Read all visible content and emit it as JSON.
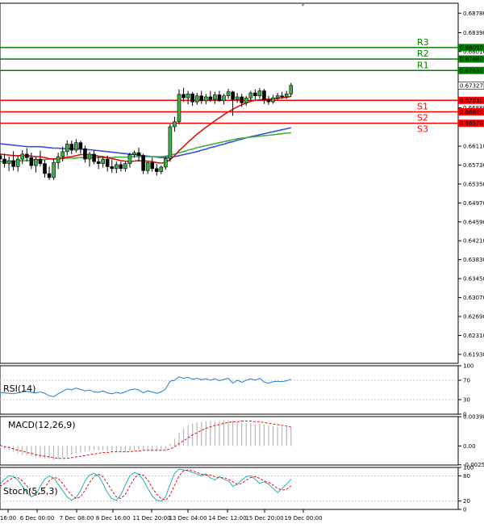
{
  "chart_data": [
    {
      "type": "candlestick",
      "panel": "price",
      "ylim": [
        0.6175,
        0.6898
      ],
      "y_ticks": [
        "0.68780",
        "0.68390",
        "0.68010",
        "0.67630",
        "0.67330",
        "0.66880",
        "0.66570",
        "0.66110",
        "0.65730",
        "0.65350",
        "0.64970",
        "0.64590",
        "0.64210",
        "0.63830",
        "0.63450",
        "0.63070",
        "0.62690",
        "0.62310",
        "0.61930"
      ],
      "y_tick_values": [
        0.6878,
        0.6839,
        0.6801,
        0.6763,
        0.6733,
        0.6688,
        0.6657,
        0.6611,
        0.6573,
        0.6535,
        0.6497,
        0.6459,
        0.6421,
        0.6383,
        0.6345,
        0.6307,
        0.6269,
        0.6231,
        0.6193
      ],
      "x_ticks": [
        "16:00",
        "6 Dec 00:00",
        "7 Dec 08:00",
        "8 Dec 16:00",
        "11 Dec 20:00",
        "13 Dec 04:00",
        "14 Dec 12:00",
        "15 Dec 20:00",
        "19 Dec 00:00"
      ],
      "levels": [
        {
          "name": "R3",
          "value": 0.6809,
          "label": "0.68090",
          "color": "#008000"
        },
        {
          "name": "R2",
          "value": 0.6786,
          "label": "0.67860",
          "color": "#008000"
        },
        {
          "name": "R1",
          "value": 0.6763,
          "label": "0.67630",
          "color": "#008000"
        },
        {
          "name": "S1",
          "value": 0.6703,
          "label": "0.67030",
          "color": "#ff0000"
        },
        {
          "name": "S2",
          "value": 0.668,
          "label": "0.66800",
          "color": "#ff0000"
        },
        {
          "name": "S3",
          "value": 0.6657,
          "label": "0.66570",
          "color": "#ff0000"
        }
      ],
      "current_price": {
        "value": 0.67327,
        "label": "0.67327"
      },
      "candles": [
        {
          "o": 0.6592,
          "h": 0.6605,
          "l": 0.6578,
          "c": 0.6585
        },
        {
          "o": 0.6585,
          "h": 0.6596,
          "l": 0.6568,
          "c": 0.6576
        },
        {
          "o": 0.6576,
          "h": 0.659,
          "l": 0.6561,
          "c": 0.6582
        },
        {
          "o": 0.6582,
          "h": 0.6601,
          "l": 0.6562,
          "c": 0.657
        },
        {
          "o": 0.657,
          "h": 0.6591,
          "l": 0.656,
          "c": 0.6585
        },
        {
          "o": 0.6585,
          "h": 0.6603,
          "l": 0.6575,
          "c": 0.6595
        },
        {
          "o": 0.6595,
          "h": 0.6607,
          "l": 0.658,
          "c": 0.6588
        },
        {
          "o": 0.6588,
          "h": 0.6598,
          "l": 0.6565,
          "c": 0.6572
        },
        {
          "o": 0.6572,
          "h": 0.659,
          "l": 0.6558,
          "c": 0.6585
        },
        {
          "o": 0.6585,
          "h": 0.6602,
          "l": 0.657,
          "c": 0.6576
        },
        {
          "o": 0.6576,
          "h": 0.6584,
          "l": 0.6548,
          "c": 0.6556
        },
        {
          "o": 0.6556,
          "h": 0.657,
          "l": 0.6543,
          "c": 0.6548
        },
        {
          "o": 0.6548,
          "h": 0.6585,
          "l": 0.6543,
          "c": 0.6578
        },
        {
          "o": 0.6578,
          "h": 0.6598,
          "l": 0.6565,
          "c": 0.659
        },
        {
          "o": 0.659,
          "h": 0.661,
          "l": 0.658,
          "c": 0.66
        },
        {
          "o": 0.66,
          "h": 0.6623,
          "l": 0.6592,
          "c": 0.6615
        },
        {
          "o": 0.6615,
          "h": 0.6622,
          "l": 0.6595,
          "c": 0.6603
        },
        {
          "o": 0.6603,
          "h": 0.6625,
          "l": 0.6598,
          "c": 0.6618
        },
        {
          "o": 0.6618,
          "h": 0.6622,
          "l": 0.6596,
          "c": 0.6606
        },
        {
          "o": 0.6606,
          "h": 0.6612,
          "l": 0.6578,
          "c": 0.6585
        },
        {
          "o": 0.6585,
          "h": 0.66,
          "l": 0.657,
          "c": 0.6595
        },
        {
          "o": 0.6595,
          "h": 0.6602,
          "l": 0.6575,
          "c": 0.658
        },
        {
          "o": 0.658,
          "h": 0.659,
          "l": 0.6565,
          "c": 0.6576
        },
        {
          "o": 0.6576,
          "h": 0.659,
          "l": 0.6568,
          "c": 0.6585
        },
        {
          "o": 0.6585,
          "h": 0.6592,
          "l": 0.656,
          "c": 0.657
        },
        {
          "o": 0.657,
          "h": 0.6584,
          "l": 0.6558,
          "c": 0.6566
        },
        {
          "o": 0.6566,
          "h": 0.658,
          "l": 0.6557,
          "c": 0.6574
        },
        {
          "o": 0.6574,
          "h": 0.658,
          "l": 0.656,
          "c": 0.6566
        },
        {
          "o": 0.6566,
          "h": 0.658,
          "l": 0.656,
          "c": 0.6576
        },
        {
          "o": 0.6576,
          "h": 0.6598,
          "l": 0.6568,
          "c": 0.6594
        },
        {
          "o": 0.6594,
          "h": 0.6602,
          "l": 0.6588,
          "c": 0.6598
        },
        {
          "o": 0.6598,
          "h": 0.6608,
          "l": 0.658,
          "c": 0.6592
        },
        {
          "o": 0.6592,
          "h": 0.6596,
          "l": 0.6555,
          "c": 0.6562
        },
        {
          "o": 0.6562,
          "h": 0.658,
          "l": 0.6555,
          "c": 0.6578
        },
        {
          "o": 0.6578,
          "h": 0.6588,
          "l": 0.656,
          "c": 0.6566
        },
        {
          "o": 0.6566,
          "h": 0.6575,
          "l": 0.6552,
          "c": 0.656
        },
        {
          "o": 0.656,
          "h": 0.6572,
          "l": 0.6555,
          "c": 0.6569
        },
        {
          "o": 0.6569,
          "h": 0.659,
          "l": 0.6564,
          "c": 0.6586
        },
        {
          "o": 0.6586,
          "h": 0.6655,
          "l": 0.658,
          "c": 0.665
        },
        {
          "o": 0.665,
          "h": 0.667,
          "l": 0.664,
          "c": 0.666
        },
        {
          "o": 0.666,
          "h": 0.6725,
          "l": 0.6655,
          "c": 0.6715
        },
        {
          "o": 0.6715,
          "h": 0.6728,
          "l": 0.67,
          "c": 0.6708
        },
        {
          "o": 0.6708,
          "h": 0.6722,
          "l": 0.6695,
          "c": 0.6716
        },
        {
          "o": 0.6716,
          "h": 0.672,
          "l": 0.6692,
          "c": 0.67
        },
        {
          "o": 0.67,
          "h": 0.6718,
          "l": 0.6694,
          "c": 0.6712
        },
        {
          "o": 0.6712,
          "h": 0.6722,
          "l": 0.6696,
          "c": 0.6702
        },
        {
          "o": 0.6702,
          "h": 0.6716,
          "l": 0.6695,
          "c": 0.671
        },
        {
          "o": 0.671,
          "h": 0.6722,
          "l": 0.67,
          "c": 0.6705
        },
        {
          "o": 0.6705,
          "h": 0.672,
          "l": 0.6696,
          "c": 0.6714
        },
        {
          "o": 0.6714,
          "h": 0.6722,
          "l": 0.67,
          "c": 0.6702
        },
        {
          "o": 0.6702,
          "h": 0.6716,
          "l": 0.6695,
          "c": 0.6712
        },
        {
          "o": 0.6712,
          "h": 0.6726,
          "l": 0.6706,
          "c": 0.672
        },
        {
          "o": 0.672,
          "h": 0.6722,
          "l": 0.6672,
          "c": 0.6705
        },
        {
          "o": 0.6705,
          "h": 0.6718,
          "l": 0.6698,
          "c": 0.671
        },
        {
          "o": 0.671,
          "h": 0.6716,
          "l": 0.669,
          "c": 0.6698
        },
        {
          "o": 0.6698,
          "h": 0.6712,
          "l": 0.6692,
          "c": 0.6708
        },
        {
          "o": 0.6708,
          "h": 0.6722,
          "l": 0.6702,
          "c": 0.6718
        },
        {
          "o": 0.6718,
          "h": 0.6725,
          "l": 0.6704,
          "c": 0.6712
        },
        {
          "o": 0.6712,
          "h": 0.6728,
          "l": 0.6706,
          "c": 0.6722
        },
        {
          "o": 0.6722,
          "h": 0.6726,
          "l": 0.6696,
          "c": 0.6704
        },
        {
          "o": 0.6704,
          "h": 0.6712,
          "l": 0.6694,
          "c": 0.67
        },
        {
          "o": 0.67,
          "h": 0.6714,
          "l": 0.6696,
          "c": 0.6708
        },
        {
          "o": 0.6708,
          "h": 0.6718,
          "l": 0.6704,
          "c": 0.6712
        },
        {
          "o": 0.6712,
          "h": 0.672,
          "l": 0.6706,
          "c": 0.671
        },
        {
          "o": 0.671,
          "h": 0.6722,
          "l": 0.6706,
          "c": 0.6716
        },
        {
          "o": 0.6716,
          "h": 0.6738,
          "l": 0.671,
          "c": 0.6733
        }
      ],
      "ma_fast": [
        0.6595,
        0.6594,
        0.6593,
        0.6592,
        0.6592,
        0.6592,
        0.6592,
        0.6591,
        0.659,
        0.659,
        0.6588,
        0.6586,
        0.6585,
        0.6586,
        0.6587,
        0.6589,
        0.659,
        0.6592,
        0.6594,
        0.6594,
        0.6594,
        0.6593,
        0.6591,
        0.659,
        0.6588,
        0.6586,
        0.6584,
        0.6582,
        0.6581,
        0.658,
        0.6581,
        0.6582,
        0.6581,
        0.6581,
        0.658,
        0.6578,
        0.6577,
        0.6578,
        0.6584,
        0.6592,
        0.6602,
        0.661,
        0.6619,
        0.6627,
        0.6635,
        0.6642,
        0.6649,
        0.6655,
        0.6662,
        0.6668,
        0.6674,
        0.668,
        0.6685,
        0.669,
        0.6694,
        0.6698,
        0.6701,
        0.6703,
        0.6704,
        0.6705,
        0.6705,
        0.6706,
        0.6707,
        0.6708,
        0.6709,
        0.6711
      ],
      "ma_slow": [
        0.6616,
        0.6615,
        0.6614,
        0.6613,
        0.6612,
        0.6611,
        0.661,
        0.661,
        0.661,
        0.661,
        0.6609,
        0.6608,
        0.6607,
        0.6607,
        0.6606,
        0.6606,
        0.6606,
        0.6606,
        0.6605,
        0.6604,
        0.6604,
        0.6603,
        0.6602,
        0.6601,
        0.66,
        0.6599,
        0.6598,
        0.6597,
        0.6596,
        0.6595,
        0.6594,
        0.6593,
        0.6592,
        0.6591,
        0.659,
        0.6589,
        0.6588,
        0.6588,
        0.6589,
        0.659,
        0.6592,
        0.6594,
        0.6596,
        0.6598,
        0.66,
        0.6603,
        0.6605,
        0.6608,
        0.661,
        0.6613,
        0.6615,
        0.6618,
        0.662,
        0.6623,
        0.6625,
        0.6628,
        0.663,
        0.6632,
        0.6634,
        0.6636,
        0.6638,
        0.664,
        0.6642,
        0.6644,
        0.6646,
        0.6648
      ],
      "ma_mid": [
        0.658,
        0.658,
        0.658,
        0.6581,
        0.6581,
        0.6582,
        0.6582,
        0.6583,
        0.6583,
        0.6584,
        0.6584,
        0.6585,
        0.6585,
        0.6586,
        0.6586,
        0.6587,
        0.6587,
        0.6587,
        0.6588,
        0.6588,
        0.6588,
        0.6588,
        0.6588,
        0.6588,
        0.6588,
        0.6588,
        0.6589,
        0.6589,
        0.6589,
        0.6589,
        0.659,
        0.659,
        0.659,
        0.659,
        0.659,
        0.659,
        0.659,
        0.6591,
        0.6593,
        0.6595,
        0.6598,
        0.66,
        0.6603,
        0.6605,
        0.6608,
        0.661,
        0.6612,
        0.6614,
        0.6616,
        0.6618,
        0.662,
        0.6622,
        0.6624,
        0.6626,
        0.6627,
        0.6628,
        0.6629,
        0.663,
        0.6631,
        0.6632,
        0.6633,
        0.6634,
        0.6635,
        0.6636,
        0.6637,
        0.6638
      ]
    },
    {
      "type": "line",
      "panel": "rsi",
      "title": "RSI(14)",
      "ylim": [
        0,
        100
      ],
      "y_ticks": [
        "100",
        "70",
        "30",
        "0"
      ],
      "y_tick_values": [
        100,
        70,
        30,
        0
      ],
      "values": [
        45,
        44,
        43,
        42,
        44,
        46,
        47,
        45,
        44,
        46,
        43,
        38,
        36,
        42,
        47,
        52,
        50,
        54,
        51,
        48,
        50,
        46,
        45,
        48,
        44,
        42,
        45,
        43,
        46,
        50,
        52,
        50,
        44,
        48,
        46,
        43,
        46,
        52,
        68,
        70,
        77,
        74,
        76,
        72,
        74,
        71,
        73,
        70,
        73,
        69,
        72,
        74,
        64,
        70,
        66,
        70,
        73,
        70,
        74,
        66,
        64,
        67,
        68,
        67,
        69,
        72
      ]
    },
    {
      "type": "line",
      "panel": "macd",
      "title": "MACD(12,26,9)",
      "y_ticks": [
        "0.00398",
        "0.00",
        "-0.00257"
      ],
      "y_tick_values": [
        0.00398,
        0.0,
        -0.00257
      ],
      "ylim": [
        -0.0026,
        0.004
      ],
      "histogram": [
        -0.0003,
        -0.0004,
        -0.0006,
        -0.0008,
        -0.001,
        -0.0012,
        -0.0013,
        -0.0014,
        -0.0015,
        -0.0016,
        -0.0017,
        -0.0018,
        -0.0019,
        -0.0018,
        -0.0016,
        -0.0014,
        -0.0012,
        -0.001,
        -0.0009,
        -0.0008,
        -0.0007,
        -0.0006,
        -0.0006,
        -0.0006,
        -0.0007,
        -0.0007,
        -0.0008,
        -0.0008,
        -0.0008,
        -0.0007,
        -0.0006,
        -0.0005,
        -0.0005,
        -0.0005,
        -0.0005,
        -0.0006,
        -0.0006,
        -0.0005,
        0.0003,
        0.001,
        0.0018,
        0.0024,
        0.0028,
        0.003,
        0.0032,
        0.0033,
        0.0034,
        0.0034,
        0.0034,
        0.0034,
        0.0035,
        0.0035,
        0.0034,
        0.0033,
        0.0032,
        0.0031,
        0.0031,
        0.003,
        0.003,
        0.0029,
        0.0028,
        0.0027,
        0.0026,
        0.0026,
        0.0026,
        0.0025
      ],
      "signal": [
        0.0001,
        -0.0001,
        -0.0002,
        -0.0004,
        -0.0006,
        -0.0007,
        -0.0009,
        -0.001,
        -0.0012,
        -0.0013,
        -0.0014,
        -0.0015,
        -0.0016,
        -0.0017,
        -0.0017,
        -0.0017,
        -0.0016,
        -0.0015,
        -0.0014,
        -0.0013,
        -0.0012,
        -0.0011,
        -0.001,
        -0.0009,
        -0.0009,
        -0.0008,
        -0.0008,
        -0.0008,
        -0.0008,
        -0.0008,
        -0.0007,
        -0.0007,
        -0.0006,
        -0.0006,
        -0.0006,
        -0.0006,
        -0.0006,
        -0.0006,
        -0.0004,
        -0.0001,
        0.0003,
        0.0007,
        0.0011,
        0.0015,
        0.0018,
        0.0021,
        0.0024,
        0.0026,
        0.0028,
        0.0029,
        0.0031,
        0.0032,
        0.0033,
        0.0033,
        0.0034,
        0.0034,
        0.0034,
        0.0033,
        0.0033,
        0.0032,
        0.0031,
        0.003,
        0.0029,
        0.0028,
        0.0027,
        0.0026
      ]
    },
    {
      "type": "line",
      "panel": "stoch",
      "title": "Stoch(5,5,3)",
      "ylim": [
        0,
        100
      ],
      "y_ticks": [
        "100",
        "80",
        "20",
        "0"
      ],
      "y_tick_values": [
        100,
        80,
        20,
        0
      ],
      "main": [
        60,
        72,
        80,
        78,
        70,
        55,
        40,
        30,
        35,
        55,
        72,
        80,
        75,
        60,
        45,
        30,
        22,
        28,
        45,
        68,
        82,
        86,
        80,
        62,
        40,
        25,
        22,
        35,
        58,
        80,
        88,
        84,
        70,
        50,
        32,
        22,
        20,
        30,
        60,
        86,
        96,
        94,
        92,
        88,
        84,
        80,
        85,
        75,
        70,
        78,
        72,
        68,
        55,
        60,
        70,
        78,
        80,
        72,
        62,
        66,
        60,
        50,
        40,
        50,
        60,
        72
      ],
      "signal": [
        55,
        62,
        70,
        76,
        76,
        68,
        56,
        42,
        34,
        38,
        52,
        68,
        76,
        74,
        62,
        46,
        34,
        26,
        30,
        46,
        64,
        78,
        84,
        78,
        62,
        44,
        30,
        26,
        36,
        56,
        74,
        84,
        82,
        70,
        52,
        36,
        26,
        22,
        34,
        58,
        80,
        92,
        94,
        92,
        88,
        84,
        82,
        82,
        78,
        75,
        76,
        72,
        66,
        60,
        62,
        70,
        76,
        78,
        74,
        68,
        64,
        58,
        50,
        46,
        48,
        56
      ]
    }
  ]
}
